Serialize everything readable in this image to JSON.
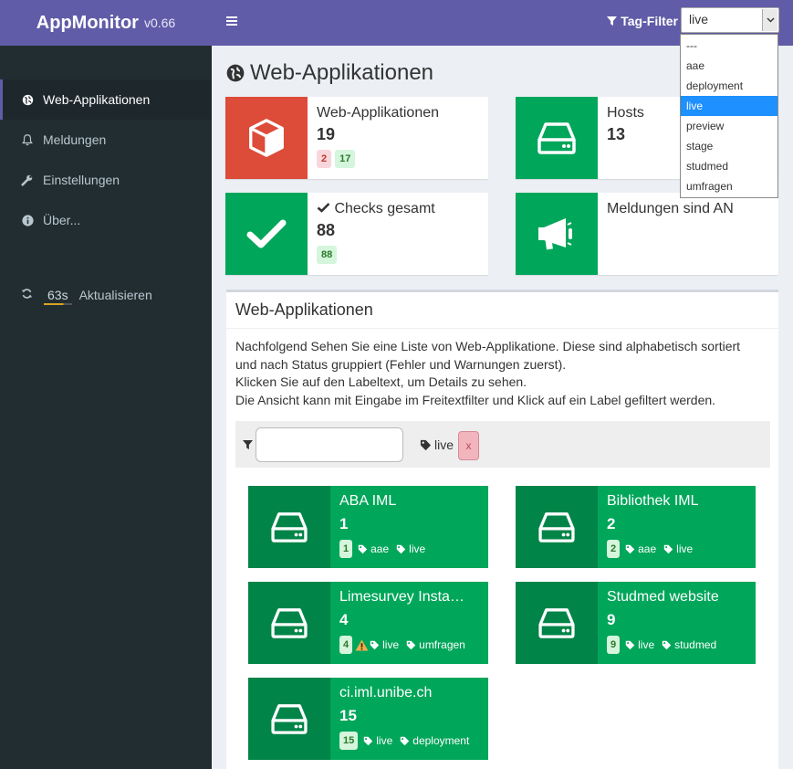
{
  "brand": {
    "app": "AppMonitor",
    "version": "v0.66"
  },
  "sidebar": {
    "items": [
      {
        "label": "Web-Applikationen",
        "icon": "globe-icon"
      },
      {
        "label": "Meldungen",
        "icon": "bell-icon"
      },
      {
        "label": "Einstellungen",
        "icon": "wrench-icon"
      },
      {
        "label": "Über...",
        "icon": "info-icon"
      }
    ],
    "refresh": {
      "seconds": "63s",
      "label": "Aktualisieren",
      "progress": 0.7
    }
  },
  "topbar": {
    "tag_filter_label": "Tag-Filter",
    "tag_filter_value": "live",
    "options": [
      "---",
      "aae",
      "deployment",
      "live",
      "preview",
      "stage",
      "studmed",
      "umfragen"
    ]
  },
  "page_title": "Web-Applikationen",
  "infoboxes": {
    "webapps": {
      "title": "Web-Applikationen",
      "number": "19",
      "badge_error": "2",
      "badge_ok": "17"
    },
    "hosts": {
      "title": "Hosts",
      "number": "13"
    },
    "checks": {
      "title": "Checks gesamt",
      "number": "88",
      "badge_ok": "88"
    },
    "notifications": {
      "title": "Meldungen sind AN"
    }
  },
  "panel": {
    "title": "Web-Applikationen",
    "intro": [
      "Nachfolgend Sehen Sie eine Liste von Web-Applikatione. Diese sind alphabetisch sortiert",
      "und nach Status gruppiert (Fehler und Warnungen zuerst).",
      "Klicken Sie auf den Labeltext, um Details zu sehen.",
      "Die Ansicht kann mit Eingabe im Freitextfilter und Klick auf ein Label gefiltert werden."
    ],
    "filter": {
      "placeholder": "",
      "active_tag": "live",
      "remove_label": "x"
    }
  },
  "apps": [
    {
      "name": "ABA IML",
      "count": "1",
      "tags": [
        "aae",
        "live"
      ],
      "warning": false
    },
    {
      "name": "Bibliothek IML",
      "count": "2",
      "tags": [
        "aae",
        "live"
      ],
      "warning": false
    },
    {
      "name": "Limesurvey Insta…",
      "count": "4",
      "tags": [
        "live",
        "umfragen"
      ],
      "warning": true
    },
    {
      "name": "Studmed website",
      "count": "9",
      "tags": [
        "live",
        "studmed"
      ],
      "warning": false
    },
    {
      "name": "ci.iml.unibe.ch",
      "count": "15",
      "tags": [
        "live",
        "deployment"
      ],
      "warning": false
    }
  ],
  "colors": {
    "brand": "#605ca8",
    "sidebar": "#222d32",
    "green": "#00a65a",
    "red": "#dd4b39"
  }
}
